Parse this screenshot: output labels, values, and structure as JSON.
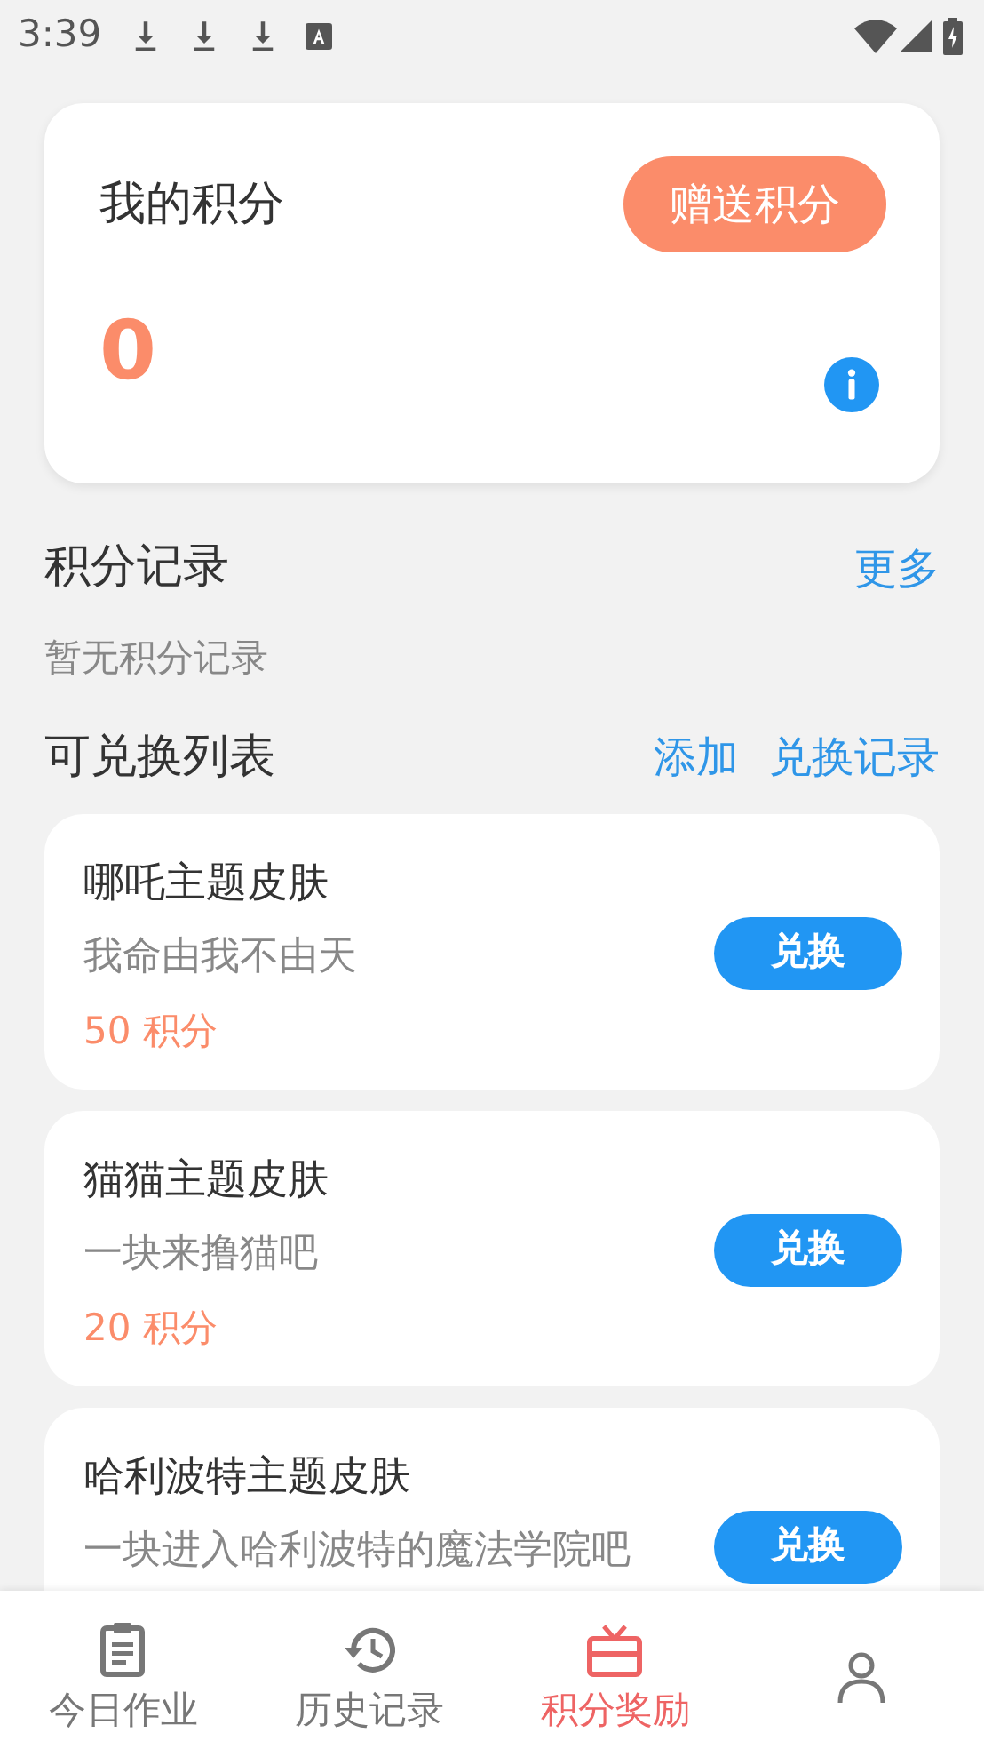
{
  "status_bar": {
    "time": "3:39"
  },
  "points_card": {
    "title": "我的积分",
    "button": "赠送积分",
    "value": "0"
  },
  "records": {
    "title": "积分记录",
    "more": "更多",
    "empty": "暂无积分记录"
  },
  "exchange": {
    "title": "可兑换列表",
    "actions": [
      "添加",
      "兑换记录"
    ],
    "items": [
      {
        "title": "哪吒主题皮肤",
        "desc": "我命由我不由天",
        "points": "50 积分",
        "button": "兑换"
      },
      {
        "title": "猫猫主题皮肤",
        "desc": "一块来撸猫吧",
        "points": "20 积分",
        "button": "兑换"
      },
      {
        "title": "哈利波特主题皮肤",
        "desc": "一块进入哈利波特的魔法学院吧",
        "button": "兑换"
      }
    ]
  },
  "bottom_nav": [
    {
      "label": "今日作业",
      "selected": false
    },
    {
      "label": "历史记录",
      "selected": false
    },
    {
      "label": "积分奖励",
      "selected": true
    },
    {
      "selected": false
    }
  ]
}
